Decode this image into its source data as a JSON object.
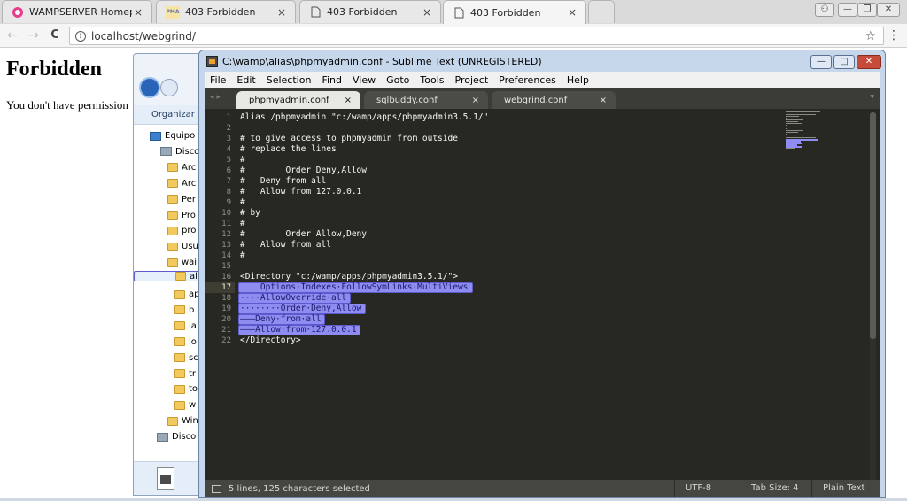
{
  "browser": {
    "tabs": [
      {
        "label": "WAMPSERVER Homepag",
        "icon": "wampserver-icon",
        "active": false
      },
      {
        "label": "403 Forbidden",
        "icon": "phpmyadmin-icon",
        "favicon_text": "PMA",
        "active": false
      },
      {
        "label": "403 Forbidden",
        "icon": "page-icon",
        "active": false
      },
      {
        "label": "403 Forbidden",
        "icon": "page-icon",
        "active": true
      }
    ],
    "close_glyph": "×",
    "window_buttons": {
      "user": "⚇",
      "minimize": "—",
      "restore": "❐",
      "close": "✕"
    },
    "address": "localhost/webgrind/",
    "nav": {
      "back": "←",
      "forward": "→",
      "reload": "C",
      "star": "☆",
      "menu": "⋮",
      "info": "i"
    }
  },
  "page": {
    "title": "Forbidden",
    "message": "You don't have permission"
  },
  "explorer": {
    "toolbar_label": "Organizar ▾",
    "tree": [
      {
        "label": "Equipo",
        "icon": "computer-icon",
        "selected": false
      },
      {
        "label": "Disco",
        "icon": "drive-icon",
        "selected": false
      },
      {
        "label": "Arc",
        "icon": "folder-icon",
        "selected": false
      },
      {
        "label": "Arc",
        "icon": "folder-icon",
        "selected": false
      },
      {
        "label": "Per",
        "icon": "folder-icon",
        "selected": false
      },
      {
        "label": "Pro",
        "icon": "folder-icon",
        "selected": false
      },
      {
        "label": "pro",
        "icon": "folder-icon",
        "selected": false
      },
      {
        "label": "Usu",
        "icon": "folder-icon",
        "selected": false
      },
      {
        "label": "wai",
        "icon": "folder-icon",
        "selected": false
      },
      {
        "label": "al",
        "icon": "folder-icon",
        "selected": true
      },
      {
        "label": "ap",
        "icon": "folder-icon",
        "selected": false
      },
      {
        "label": "b",
        "icon": "folder-icon",
        "selected": false
      },
      {
        "label": "la",
        "icon": "folder-icon",
        "selected": false
      },
      {
        "label": "lo",
        "icon": "folder-icon",
        "selected": false
      },
      {
        "label": "sc",
        "icon": "folder-icon",
        "selected": false
      },
      {
        "label": "tr",
        "icon": "folder-icon",
        "selected": false
      },
      {
        "label": "to",
        "icon": "folder-icon",
        "selected": false
      },
      {
        "label": "w",
        "icon": "folder-icon",
        "selected": false
      },
      {
        "label": "Win",
        "icon": "folder-icon",
        "selected": false
      },
      {
        "label": "Disco",
        "icon": "drive-icon",
        "selected": false
      }
    ]
  },
  "sublime": {
    "title": "C:\\wamp\\alias\\phpmyadmin.conf - Sublime Text (UNREGISTERED)",
    "menu": [
      "File",
      "Edit",
      "Selection",
      "Find",
      "View",
      "Goto",
      "Tools",
      "Project",
      "Preferences",
      "Help"
    ],
    "tabs": [
      {
        "label": "phpmyadmin.conf",
        "active": true
      },
      {
        "label": "sqlbuddy.conf",
        "active": false
      },
      {
        "label": "webgrind.conf",
        "active": false
      }
    ],
    "tab_close": "×",
    "tab_arrows": "◂ ▸",
    "tab_dropdown": "▾",
    "current_line": 17,
    "lines": [
      "Alias /phpmyadmin \"c:/wamp/apps/phpmyadmin3.5.1/\"",
      "",
      "# to give access to phpmyadmin from outside",
      "# replace the lines",
      "#",
      "#        Order Deny,Allow",
      "#   Deny from all",
      "#   Allow from 127.0.0.1",
      "#",
      "# by",
      "#",
      "#        Order Allow,Deny",
      "#   Allow from all",
      "#",
      "",
      "<Directory \"c:/wamp/apps/phpmyadmin3.5.1/\">",
      "    Options·Indexes·FollowSymLinks·MultiViews",
      "····AllowOverride·all",
      "········Order·Deny,Allow",
      "———Deny·from·all",
      "———Allow·from·127.0.0.1",
      "</Directory>"
    ],
    "selected_lines": [
      17,
      18,
      19,
      20,
      21
    ],
    "status": {
      "selection": "5 lines, 125 characters selected",
      "encoding": "UTF-8",
      "tab_size": "Tab Size: 4",
      "syntax": "Plain Text"
    }
  }
}
